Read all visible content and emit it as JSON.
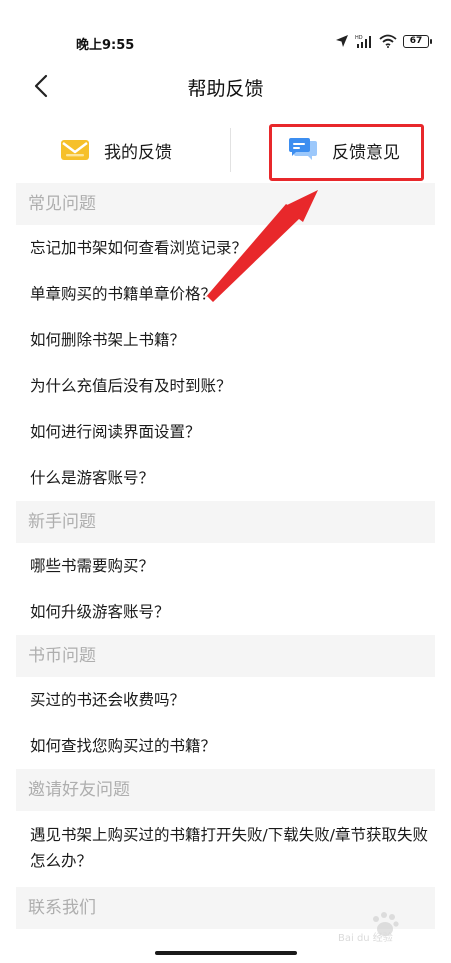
{
  "status_bar": {
    "time": "晚上9:55",
    "battery": "67",
    "network_label": "HD"
  },
  "nav": {
    "title": "帮助反馈"
  },
  "tabs": [
    {
      "label": "我的反馈",
      "icon": "mail-icon",
      "color": "#f6c02a"
    },
    {
      "label": "反馈意见",
      "icon": "chat-bubbles-icon",
      "color": "#3d8ef0"
    }
  ],
  "sections": [
    {
      "title": "常见问题",
      "items": [
        "忘记加书架如何查看浏览记录？",
        "单章购买的书籍单章价格？",
        "如何删除书架上书籍？",
        "为什么充值后没有及时到账？",
        "如何进行阅读界面设置？",
        "什么是游客账号？"
      ]
    },
    {
      "title": "新手问题",
      "items": [
        "哪些书需要购买？",
        "如何升级游客账号？"
      ]
    },
    {
      "title": "书币问题",
      "items": [
        "买过的书还会收费吗？",
        "如何查找您购买过的书籍？"
      ]
    },
    {
      "title": "邀请好友问题",
      "items": [
        "遇见书架上购买过的书籍打开失败/下载失败/章节获取失败怎么办？"
      ]
    },
    {
      "title": "联系我们",
      "items": []
    }
  ],
  "annotation": {
    "color": "#e8282b"
  },
  "watermark": {
    "text": "Bai du 经验"
  }
}
